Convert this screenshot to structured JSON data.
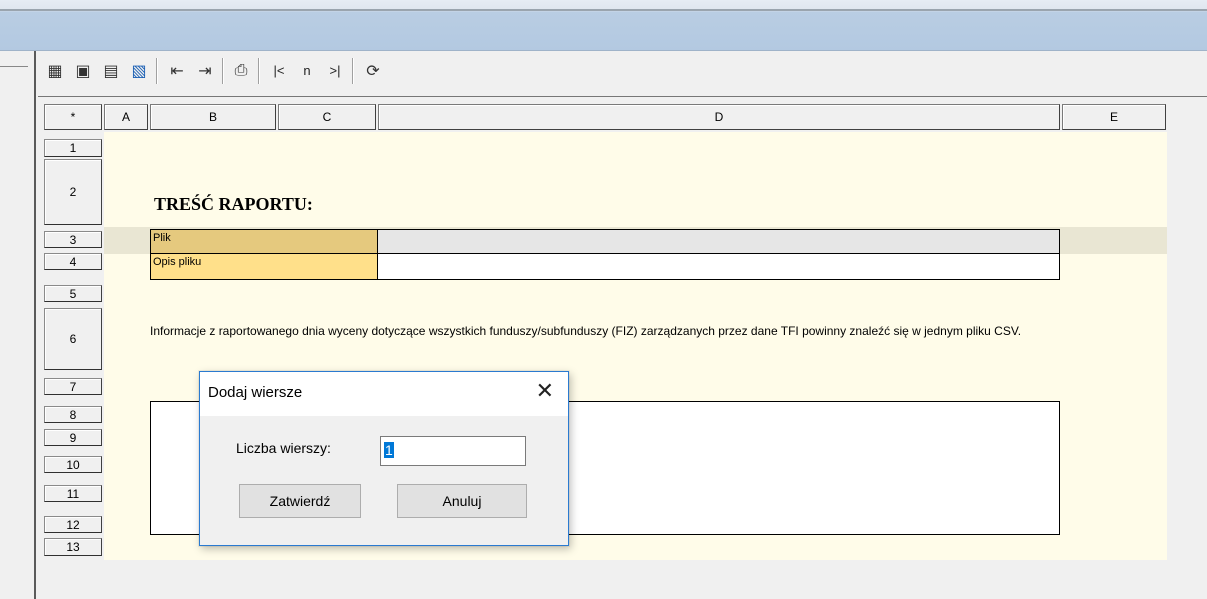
{
  "toolbar": {
    "icons": [
      "table-icon",
      "save-icon",
      "save-as-icon",
      "attach-icon",
      "indent-decrease-icon",
      "indent-increase-icon",
      "print-icon"
    ],
    "nav_first": "|<",
    "nav_n": "n",
    "nav_last": ">|",
    "refresh_icon": "refresh-icon"
  },
  "sheet": {
    "corner": "*",
    "columns": [
      "A",
      "B",
      "C",
      "D",
      "E"
    ],
    "rows": [
      "1",
      "2",
      "3",
      "4",
      "5",
      "6",
      "7",
      "8",
      "9",
      "10",
      "11",
      "12",
      "13"
    ],
    "report_title": "TREŚĆ RAPORTU:",
    "file_label": "Plik",
    "file_desc_label": "Opis pliku",
    "info_text": "Informacje z raportowanego dnia wyceny dotyczące wszystkich funduszy/subfunduszy (FIZ) zarządzanych przez dane TFI powinny znaleźć się w jednym pliku CSV."
  },
  "dialog": {
    "title": "Dodaj wiersze",
    "close": "✕",
    "rows_label": "Liczba wierszy:",
    "rows_value": "1",
    "confirm_label": "Zatwierdź",
    "cancel_label": "Anuluj"
  },
  "colors": {
    "cream": "#fffce9",
    "file_label_bg": "#e5c97e",
    "file_desc_bg": "#ffe08a",
    "accent": "#0078d7"
  }
}
